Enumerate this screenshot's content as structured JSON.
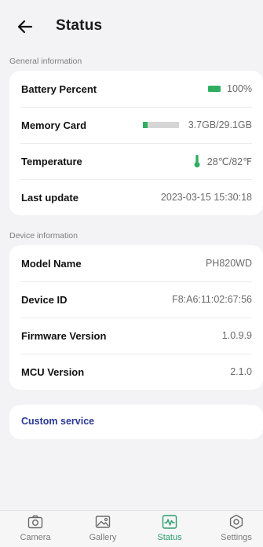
{
  "header": {
    "title": "Status"
  },
  "sections": {
    "general_label": "General information",
    "device_label": "Device information"
  },
  "general": {
    "battery": {
      "label": "Battery Percent",
      "value": "100%",
      "level": 1.0
    },
    "memory": {
      "label": "Memory Card",
      "value": "3.7GB/29.1GB",
      "used_fraction": 0.127
    },
    "temperature": {
      "label": "Temperature",
      "value": "28℃/82℉"
    },
    "last_update": {
      "label": "Last update",
      "value": "2023-03-15 15:30:18"
    }
  },
  "device": {
    "model": {
      "label": "Model Name",
      "value": "PH820WD"
    },
    "device_id": {
      "label": "Device ID",
      "value": "F8:A6:11:02:67:56"
    },
    "firmware": {
      "label": "Firmware Version",
      "value": "1.0.9.9"
    },
    "mcu": {
      "label": "MCU Version",
      "value": "2.1.0"
    }
  },
  "custom_service": {
    "label": "Custom service"
  },
  "nav": [
    {
      "label": "Camera",
      "icon": "camera-icon"
    },
    {
      "label": "Gallery",
      "icon": "gallery-icon"
    },
    {
      "label": "Status",
      "icon": "status-icon",
      "active": true
    },
    {
      "label": "Settings",
      "icon": "settings-icon"
    }
  ],
  "colors": {
    "accent_green": "#2fae61",
    "active_nav": "#2a9d6d",
    "link_blue": "#2b3a96"
  }
}
